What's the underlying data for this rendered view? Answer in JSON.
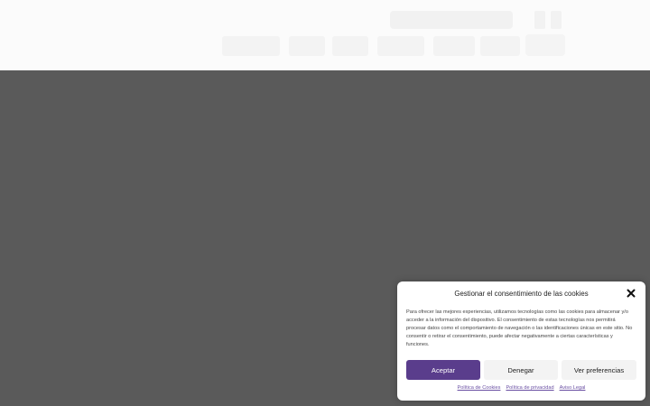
{
  "cookie_dialog": {
    "title": "Gestionar el consentimiento de las cookies",
    "close_icon": "close-icon",
    "body": "Para ofrecer las mejores experiencias, utilizamos tecnologías como las cookies para almacenar y/o acceder a la información del dispositivo. El consentimiento de estas tecnologías nos permitirá procesar datos como el comportamiento de navegación o las identificaciones únicas en este sitio. No consentir o retirar el consentimiento, puede afectar negativamente a ciertas características y funciones.",
    "buttons": {
      "accept": "Aceptar",
      "deny": "Denegar",
      "preferences": "Ver preferencias"
    },
    "links": {
      "cookies_policy": "Política de Cookies",
      "privacy_policy": "Política de privacidad",
      "legal_notice": "Aviso Legal"
    }
  },
  "colors": {
    "accent": "#5a3d8c",
    "overlay": "#5a5a5a",
    "link": "#6a4fa3"
  }
}
